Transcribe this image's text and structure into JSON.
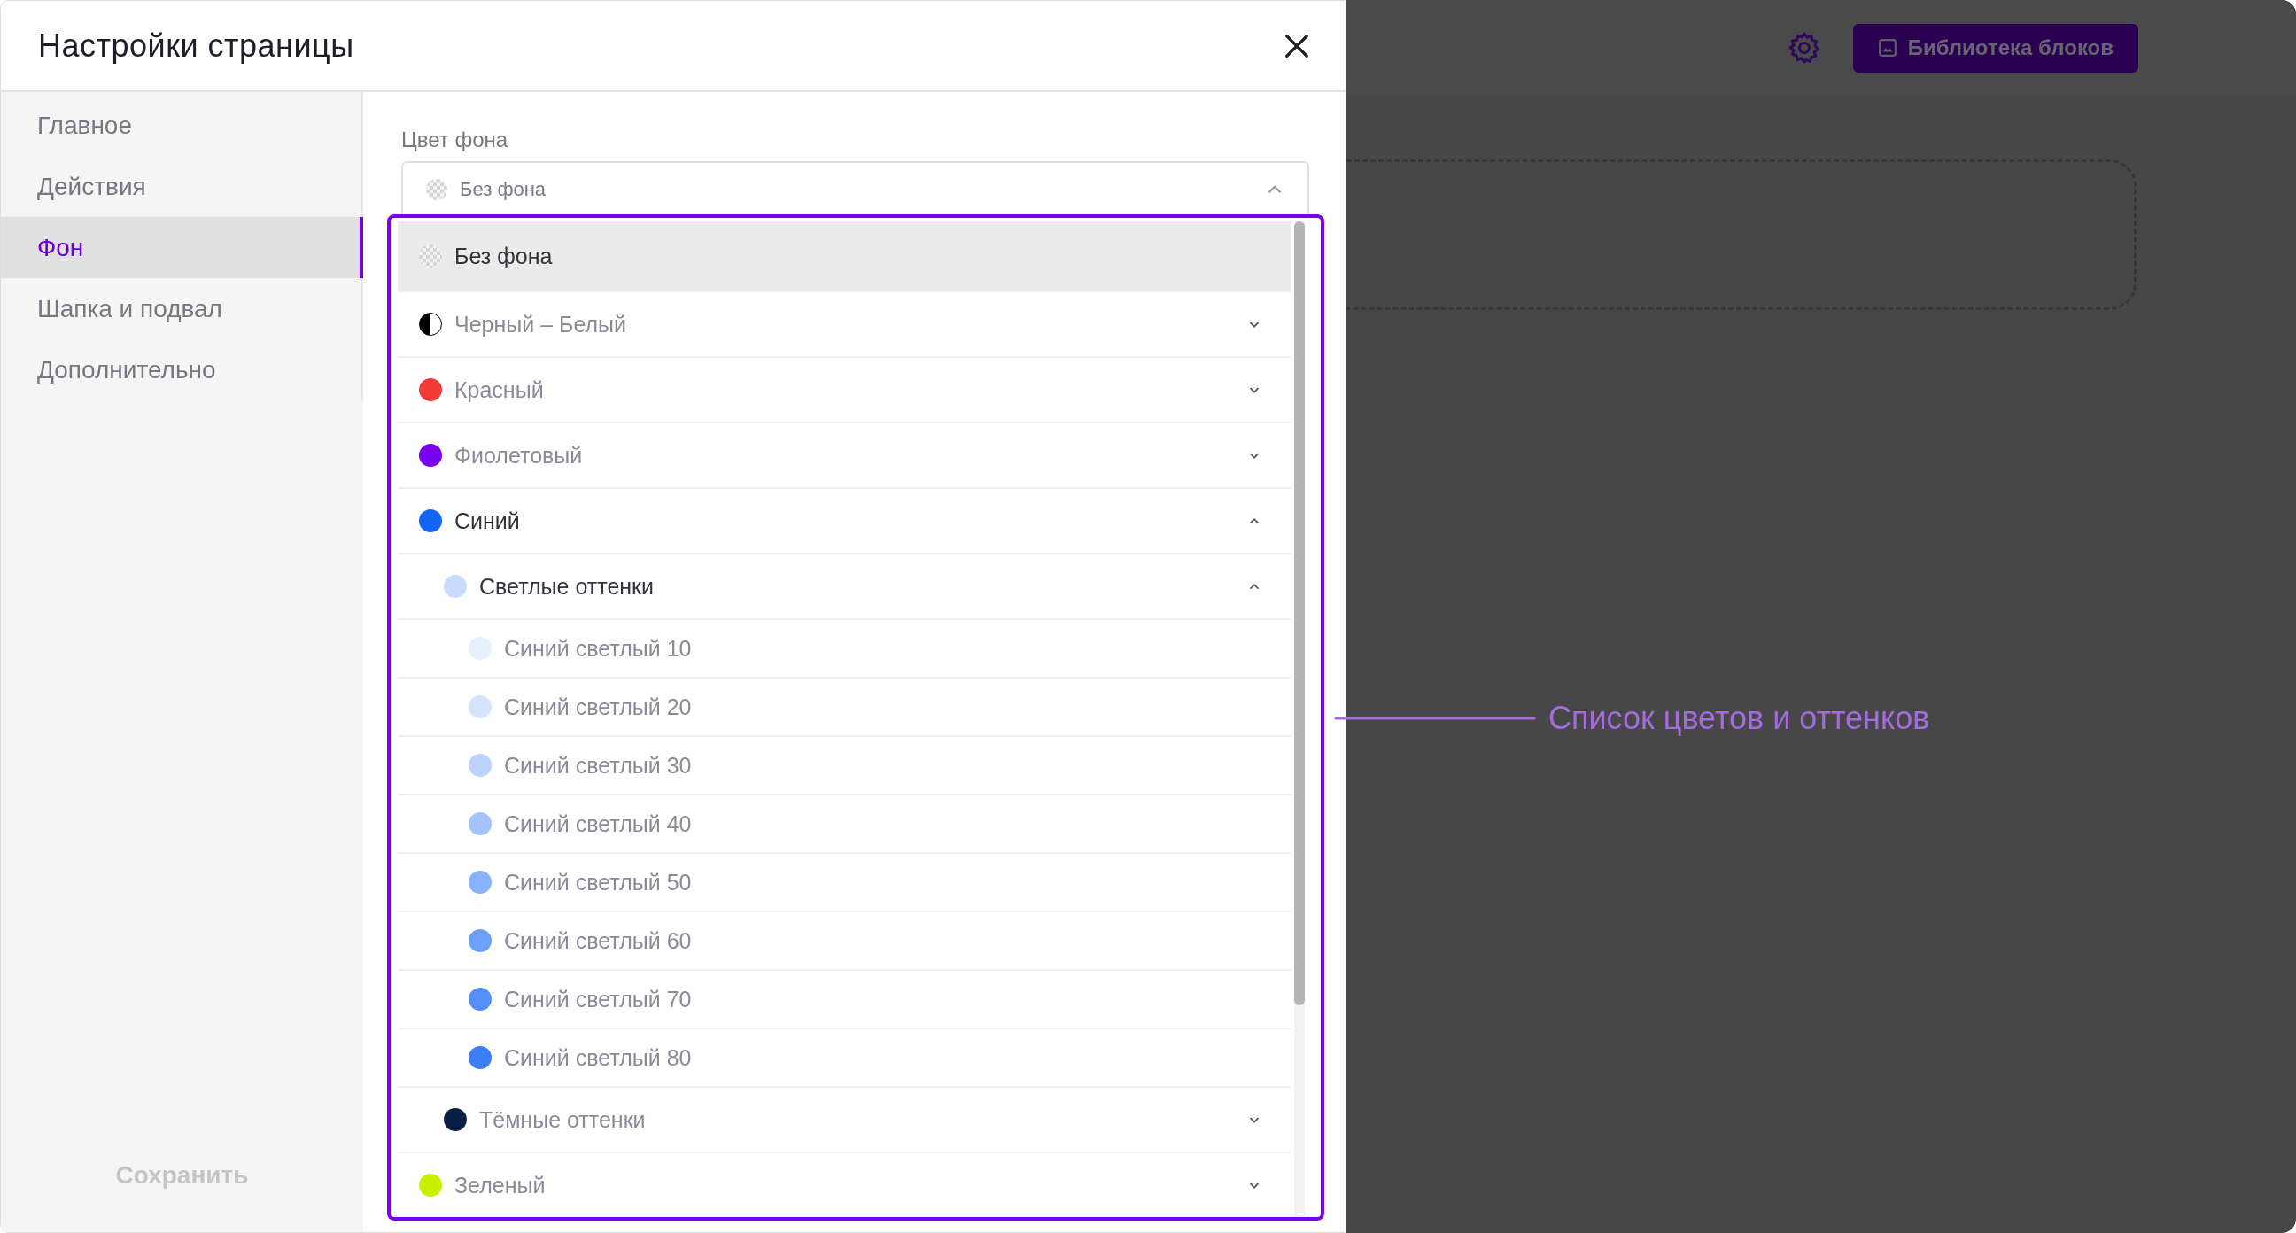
{
  "dialog": {
    "title": "Настройки страницы"
  },
  "sidebar": {
    "items": [
      {
        "label": "Главное",
        "selected": false
      },
      {
        "label": "Действия",
        "selected": false
      },
      {
        "label": "Фон",
        "selected": true
      },
      {
        "label": "Шапка и подвал",
        "selected": false
      },
      {
        "label": "Дополнительно",
        "selected": false
      }
    ]
  },
  "save_button": {
    "label": "Сохранить",
    "disabled": true
  },
  "field": {
    "label": "Цвет фона",
    "value": "Без фона",
    "expanded": true
  },
  "options": [
    {
      "label": "Без фона",
      "kind": "none",
      "selected": true
    },
    {
      "label": "Черный – Белый",
      "kind": "split",
      "selected": false,
      "expanded": false
    },
    {
      "label": "Красный",
      "kind": "solid",
      "color": "#f23c37",
      "selected": false,
      "expanded": false
    },
    {
      "label": "Фиолетовый",
      "kind": "solid",
      "color": "#7a00f0",
      "selected": false,
      "expanded": false
    },
    {
      "label": "Синий",
      "kind": "solid",
      "color": "#1464f5",
      "selected": false,
      "expanded": true,
      "children": [
        {
          "label": "Светлые оттенки",
          "kind": "solid",
          "color": "#c9dcfd",
          "selected": false,
          "expanded": true,
          "children": [
            {
              "label": "Синий светлый 10",
              "kind": "solid",
              "color": "#e6efff",
              "selected": false
            },
            {
              "label": "Синий светлый 20",
              "kind": "solid",
              "color": "#d4e4fe",
              "selected": false
            },
            {
              "label": "Синий светлый 30",
              "kind": "solid",
              "color": "#bcd4fd",
              "selected": false
            },
            {
              "label": "Синий светлый 40",
              "kind": "solid",
              "color": "#a2c3fc",
              "selected": false
            },
            {
              "label": "Синий светлый 50",
              "kind": "solid",
              "color": "#88b2fb",
              "selected": false
            },
            {
              "label": "Синий светлый 60",
              "kind": "solid",
              "color": "#6ea0fa",
              "selected": false
            },
            {
              "label": "Синий светлый 70",
              "kind": "solid",
              "color": "#548ff9",
              "selected": false
            },
            {
              "label": "Синий светлый 80",
              "kind": "solid",
              "color": "#3a7ef8",
              "selected": false
            }
          ]
        },
        {
          "label": "Тёмные оттенки",
          "kind": "solid",
          "color": "#0a1e46",
          "selected": false,
          "expanded": false
        }
      ]
    },
    {
      "label": "Зеленый",
      "kind": "solid",
      "color": "#c8f000",
      "selected": false,
      "expanded": false
    }
  ],
  "toolbar": {
    "library_button": "Библиотека блоков"
  },
  "annotation": "Список цветов и оттенков"
}
